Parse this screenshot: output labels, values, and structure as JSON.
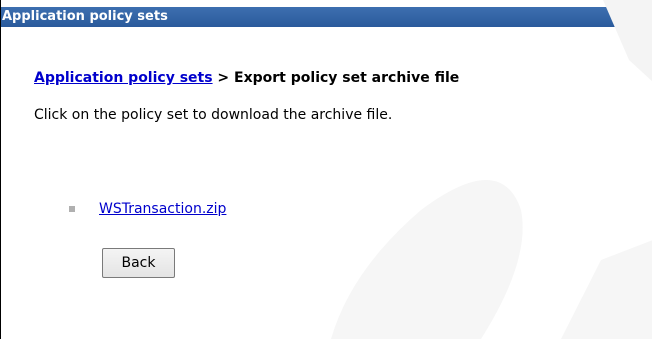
{
  "header": {
    "title": "Application policy sets"
  },
  "breadcrumb": {
    "link_label": "Application policy sets",
    "separator": " > ",
    "current": "Export policy set archive file"
  },
  "instruction": "Click on the policy set to download the archive file.",
  "files": [
    {
      "name": "WSTransaction.zip"
    }
  ],
  "actions": {
    "back_label": "Back"
  },
  "colors": {
    "header_bg": "#2f619f",
    "link": "#0000cc",
    "bullet": "#b0b0b0"
  }
}
